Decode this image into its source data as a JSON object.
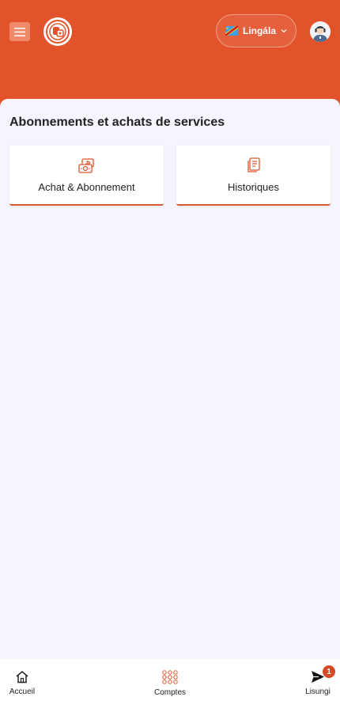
{
  "header": {
    "language": {
      "label": "Lingála",
      "flag": "drc-flag"
    },
    "brand_color": "#e2532b"
  },
  "main": {
    "section_title": "Abonnements et achats de services",
    "cards": [
      {
        "label": "Achat & Abonnement",
        "icon": "money-purchase-icon"
      },
      {
        "label": "Historiques",
        "icon": "receipt-history-icon"
      }
    ]
  },
  "bottom_nav": {
    "items": [
      {
        "label": "Accueil",
        "icon": "home-icon"
      },
      {
        "label": "Comptes",
        "icon": "grid-dots-icon"
      },
      {
        "label": "Lisungi",
        "icon": "send-icon",
        "badge": "1"
      }
    ]
  }
}
